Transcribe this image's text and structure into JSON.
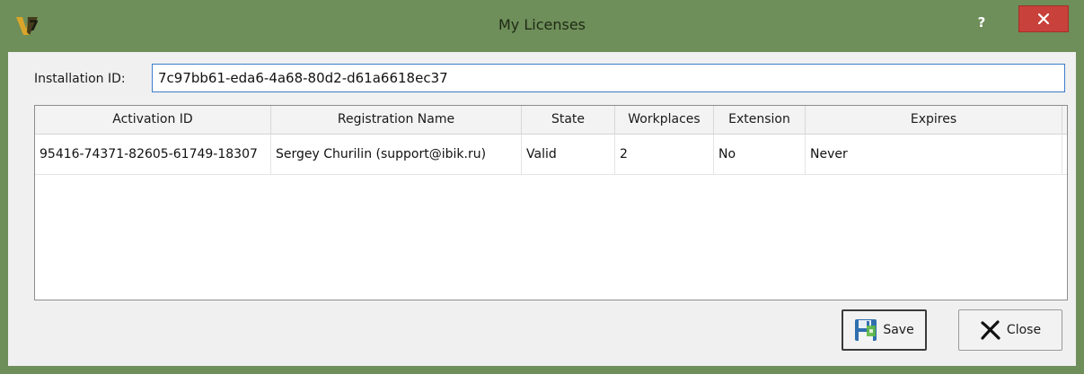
{
  "window": {
    "title": "My Licenses",
    "help_label": "?",
    "logo_text": "v7"
  },
  "installation": {
    "label": "Installation ID:",
    "value": "7c97bb61-eda6-4a68-80d2-d61a6618ec37"
  },
  "table": {
    "columns": [
      "Activation ID",
      "Registration Name",
      "State",
      "Workplaces",
      "Extension",
      "Expires"
    ],
    "rows": [
      {
        "activation_id": "95416-74371-82605-61749-18307",
        "registration_name": "Sergey Churilin (support@ibik.ru)",
        "state": "Valid",
        "workplaces": "2",
        "extension": "No",
        "expires": "Never"
      }
    ]
  },
  "buttons": {
    "save_label": "Save",
    "close_label": "Close"
  },
  "colors": {
    "frame": "#6e8e5a",
    "close_red": "#c8413a",
    "input_border": "#3d7bcc"
  },
  "icons": {
    "save": "floppy-disk-icon",
    "close": "x-icon",
    "window_close": "close-icon"
  }
}
